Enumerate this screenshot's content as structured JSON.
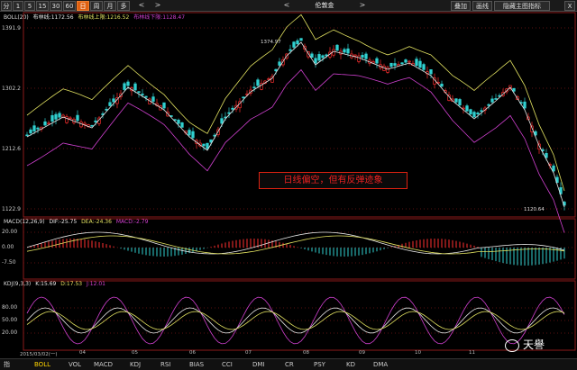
{
  "toolbar": {
    "periods": [
      "分",
      "1",
      "5",
      "15",
      "30",
      "60",
      "日",
      "周",
      "月",
      "多"
    ],
    "active_period": "日",
    "nav_left": "<",
    "nav_right": ">",
    "symbol": "伦敦金",
    "symbol_nav_left": "<",
    "symbol_nav_right": ">",
    "right_buttons": [
      "叠加",
      "画线",
      "隐藏主图指标"
    ],
    "close": "X"
  },
  "main": {
    "legend": {
      "name": "BOLL(20)",
      "mid": "布林线:1172.56",
      "upper": "布林线上限:1216.52",
      "lower": "布林线下限:1128.47"
    },
    "y_ticks": [
      "1391.9",
      "1302.2",
      "1212.6",
      "1122.9"
    ],
    "high_label": "1374.97",
    "low_label": "1120.64",
    "annotation": "日线偏空，但有反弹迹象"
  },
  "macd": {
    "legend": {
      "name": "MACD(12,26,9)",
      "dif": "DIF:-25.75",
      "dea": "DEA:-24.36",
      "macd": "MACD:-2.79"
    },
    "y_ticks": [
      "20.00",
      "0.00",
      "-7.50"
    ]
  },
  "kdj": {
    "legend": {
      "name": "KDJ(9,3,3)",
      "k": "K:15.69",
      "d": "D:17.53",
      "j": "J:12.01"
    },
    "y_ticks": [
      "80.00",
      "50.00",
      "20.00"
    ]
  },
  "date_axis": [
    "2015/03/02(一)",
    "04",
    "05",
    "06",
    "07",
    "08",
    "09",
    "10",
    "11"
  ],
  "tabs": [
    "指",
    "BOLL",
    "VOL",
    "MACD",
    "KDJ",
    "RSI",
    "BIAS",
    "CCI",
    "DMI",
    "CR",
    "PSY",
    "KD",
    "DMA"
  ],
  "active_tab": "BOLL",
  "watermark": "天譽",
  "colors": {
    "up": "#ff3030",
    "down": "#30d0d0",
    "mid_line": "#e8e8e8",
    "upper_line": "#e0e060",
    "lower_line": "#d040d0",
    "accent": "#e06010",
    "annotation": "#dd2222"
  }
}
